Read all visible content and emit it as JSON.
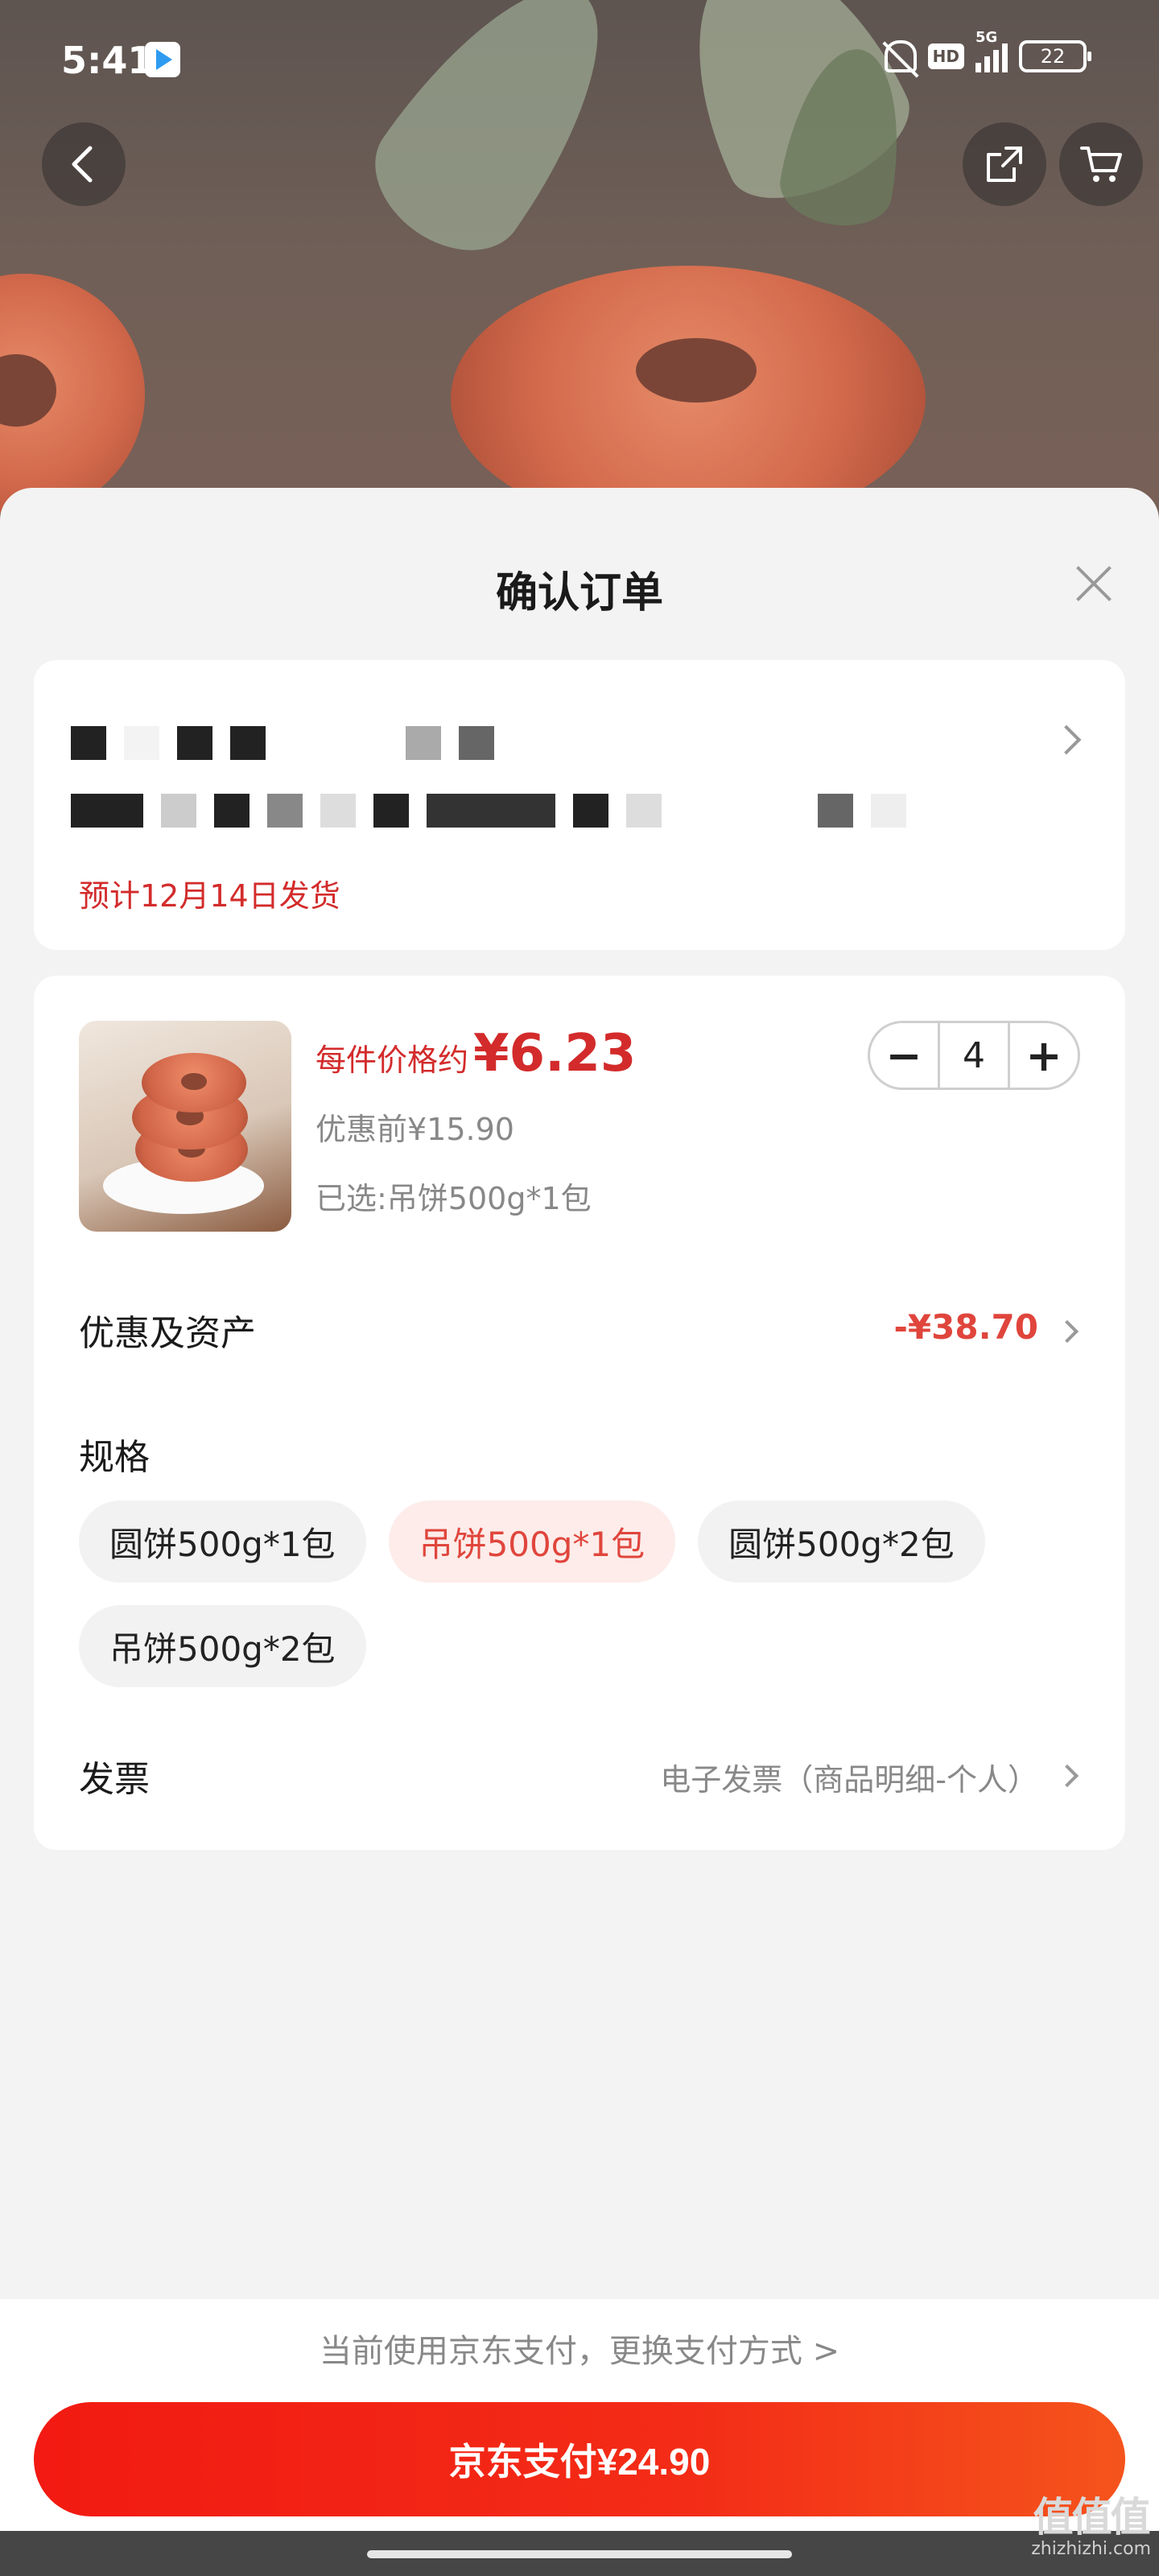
{
  "status_bar": {
    "time": "5:41",
    "network_label": "5G",
    "hd_label": "HD",
    "battery": "22",
    "icons": [
      "play-store-icon",
      "bell-off-icon",
      "hd-icon",
      "signal-icon",
      "battery-icon"
    ]
  },
  "top_nav": {
    "icons": [
      "back-arrow-icon",
      "share-icon",
      "cart-icon"
    ]
  },
  "sheet": {
    "title": "确认订单",
    "close_icon": "close-icon"
  },
  "address": {
    "ship_estimate": "预计12月14日发货"
  },
  "product": {
    "price_prefix": "每件价格约",
    "price": "¥6.23",
    "original_price": "优惠前¥15.90",
    "selected_spec": "已选:吊饼500g*1包",
    "quantity": "4",
    "minus_label": "−",
    "plus_label": "+"
  },
  "discount": {
    "label": "优惠及资产",
    "value": "-¥38.70"
  },
  "spec": {
    "label": "规格",
    "options": [
      {
        "label": "圆饼500g*1包",
        "selected": false
      },
      {
        "label": "吊饼500g*1包",
        "selected": true
      },
      {
        "label": "圆饼500g*2包",
        "selected": false
      },
      {
        "label": "吊饼500g*2包",
        "selected": false
      }
    ]
  },
  "invoice": {
    "label": "发票",
    "value": "电子发票（商品明细-个人）"
  },
  "bottom": {
    "pay_hint": "当前使用京东支付，更换支付方式 >",
    "pay_button": "京东支付¥24.90"
  },
  "watermark": {
    "logo": "值值值",
    "site": "zhizhizhi.com"
  },
  "colors": {
    "accent_red": "#e0453c",
    "price_red": "#d32b2b",
    "pay_gradient_start": "#f21a12",
    "pay_gradient_end": "#f5541c"
  }
}
